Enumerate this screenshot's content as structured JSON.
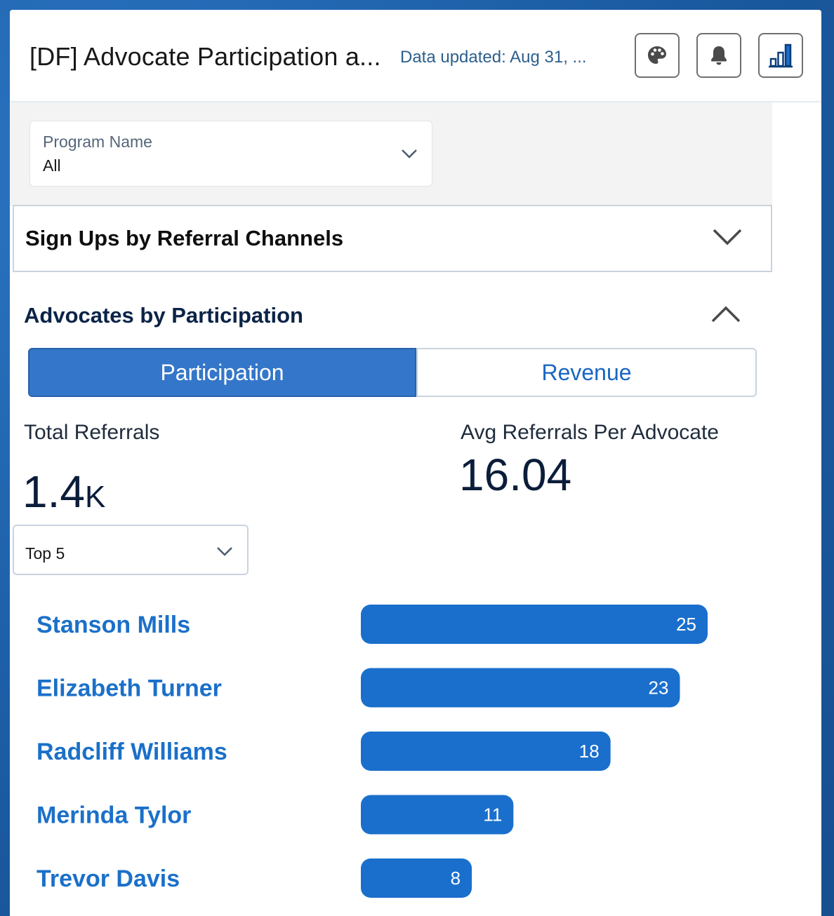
{
  "header": {
    "title": "[DF] Advocate Participation a...",
    "data_updated": "Data updated: Aug 31, ...",
    "buttons": [
      {
        "icon": "palette-icon"
      },
      {
        "icon": "bell-icon"
      },
      {
        "icon": "bar-chart-icon"
      }
    ]
  },
  "filter": {
    "label": "Program Name",
    "value": "All"
  },
  "sections": {
    "signups": {
      "title": "Sign Ups by Referral Channels",
      "expanded": false
    },
    "advocates": {
      "title": "Advocates by Participation",
      "expanded": true
    }
  },
  "tabs": [
    {
      "label": "Participation",
      "active": true
    },
    {
      "label": "Revenue",
      "active": false
    }
  ],
  "kpis": {
    "total_referrals": {
      "label": "Total Referrals",
      "value": "1.4",
      "unit": "K"
    },
    "avg_referrals": {
      "label": "Avg Referrals Per Advocate",
      "value": "16.04"
    }
  },
  "top_select": {
    "value": "Top 5"
  },
  "colors": {
    "accent": "#3476c9",
    "bar": "#1a6fcc",
    "link": "#1b70c9"
  },
  "chart_data": {
    "type": "bar",
    "orientation": "horizontal",
    "categories": [
      "Stanson Mills",
      "Elizabeth Turner",
      "Radcliff Williams",
      "Merinda Tylor",
      "Trevor Davis"
    ],
    "values": [
      25,
      23,
      18,
      11,
      8
    ],
    "data_labels": true,
    "grid": false
  }
}
